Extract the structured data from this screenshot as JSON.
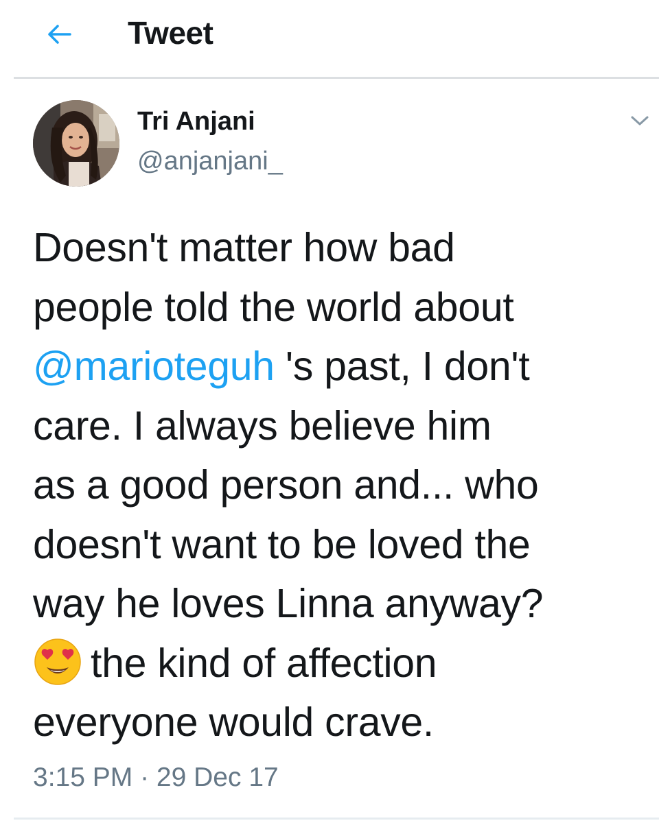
{
  "header": {
    "title": "Tweet",
    "back_icon": "arrow-left-icon",
    "accent_color": "#1da1f2"
  },
  "author": {
    "display_name": "Tri Anjani",
    "handle": "@anjanjani_",
    "avatar_icon": "profile-photo"
  },
  "tweet": {
    "lines": [
      {
        "text": "Doesn't matter how bad"
      },
      {
        "text": "people told the world about"
      },
      {
        "mention": "@marioteguh",
        "rest": " 's past, I don't"
      },
      {
        "text": "care. I always believe him"
      },
      {
        "text": "as a good person and... who"
      },
      {
        "text": "doesn't want to be loved the"
      },
      {
        "text": "way he loves Linna anyway?"
      },
      {
        "emoji": "heart-eyes-emoji",
        "rest": "the kind of affection"
      },
      {
        "text": "everyone would crave."
      }
    ],
    "mention_color": "#1da1f2"
  },
  "timestamp": {
    "time": "3:15 PM",
    "separator": " · ",
    "date": "29 Dec 17"
  },
  "menu_icon": "chevron-down-icon"
}
